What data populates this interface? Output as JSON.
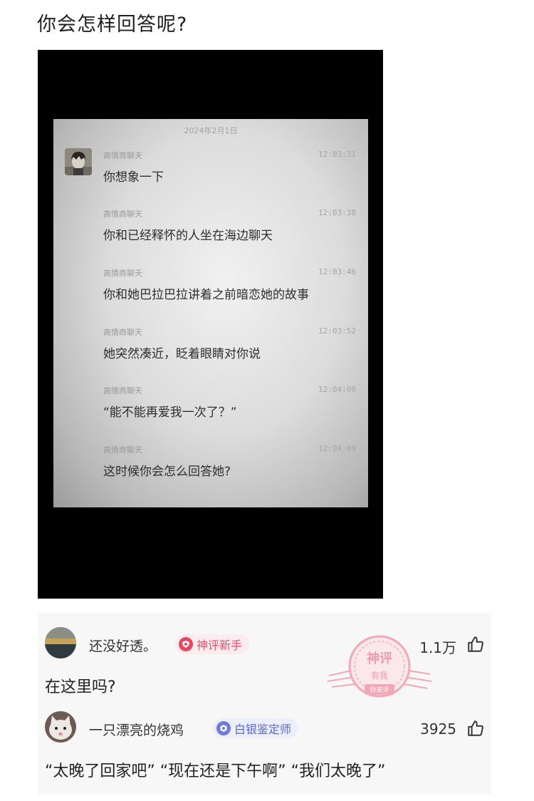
{
  "post": {
    "title": "你会怎样回答呢?"
  },
  "screenshot": {
    "date": "2024年2月1日",
    "messages": [
      {
        "sender": "高情商聊天",
        "time": "12:03:31",
        "text": "你想象一下"
      },
      {
        "sender": "高情商聊天",
        "time": "12:03:38",
        "text": "你和已经释怀的人坐在海边聊天"
      },
      {
        "sender": "高情商聊天",
        "time": "12:03:46",
        "text": "你和她巴拉巴拉讲着之前暗恋她的故事"
      },
      {
        "sender": "高情商聊天",
        "time": "12:03:52",
        "text": "她突然凑近，眨着眼睛对你说"
      },
      {
        "sender": "高情商聊天",
        "time": "12:04:00",
        "text": "“能不能再爱我一次了？”"
      },
      {
        "sender": "高情商聊天",
        "time": "12:04:09",
        "text": "这时候你会怎么回答她?"
      }
    ]
  },
  "comments": [
    {
      "username": "还没好透。",
      "badge": "神评新手",
      "likes": "1.1万",
      "text": "在这里吗?",
      "stamp": {
        "line1": "神评",
        "line2": "有我",
        "line3": "你来评"
      }
    },
    {
      "username": "一只漂亮的烧鸡",
      "badge": "白银鉴定师",
      "likes": "3925",
      "text": "“太晚了回家吧” “现在还是下午啊” “我们太晚了”"
    }
  ],
  "colors": {
    "badge_red": "#e24a62",
    "badge_blue": "#6f7bd6",
    "stamp_pink": "#ef8fa3"
  },
  "icons": {
    "like": "thumbs-up-icon",
    "badge_red": "shield-badge-icon",
    "badge_blue": "medal-badge-icon"
  }
}
